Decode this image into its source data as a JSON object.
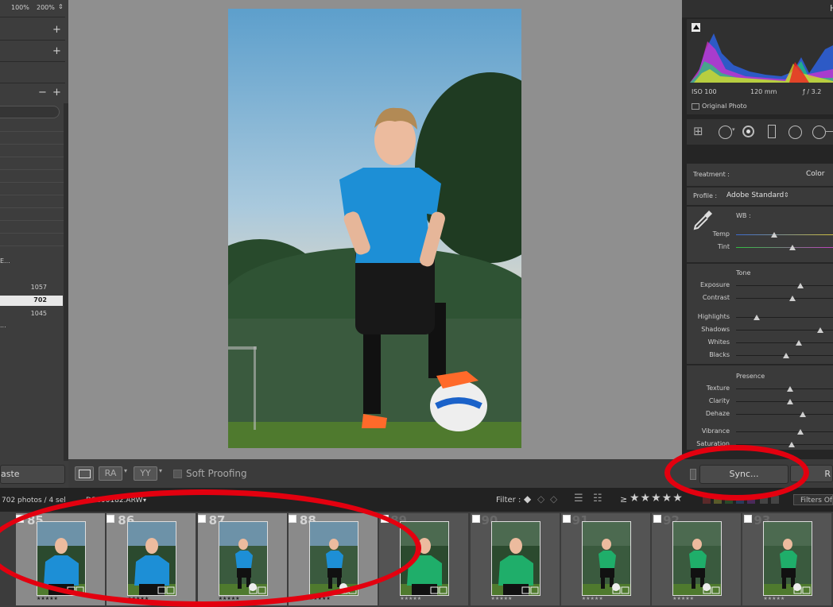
{
  "left_panel": {
    "zoom_options": [
      "100%",
      "200%"
    ],
    "counts": [
      "1057",
      "702",
      "1045"
    ],
    "truncated_item": "E...",
    "dots": "...",
    "paste_label": "aste"
  },
  "toolbar": {
    "ra_label": "RA",
    "yy_label": "YY",
    "soft_proofing_label": "Soft Proofing"
  },
  "right_panel": {
    "top_letter": "H",
    "histogram_info": {
      "iso": "ISO 100",
      "focal": "120 mm",
      "aperture": "ƒ / 3.2"
    },
    "original_photo_label": "Original Photo",
    "treatment_label": "Treatment :",
    "treatment_value": "Color",
    "profile_label": "Profile :",
    "profile_value": "Adobe Standard",
    "wb_label": "WB :",
    "sliders_wb": [
      {
        "label": "Temp",
        "value": 0.39
      },
      {
        "label": "Tint",
        "value": 0.58
      }
    ],
    "tone_label": "Tone",
    "sliders_tone_a": [
      {
        "label": "Exposure",
        "value": 0.66
      },
      {
        "label": "Contrast",
        "value": 0.58
      }
    ],
    "sliders_tone_b": [
      {
        "label": "Highlights",
        "value": 0.21
      },
      {
        "label": "Shadows",
        "value": 0.87
      },
      {
        "label": "Whites",
        "value": 0.65
      },
      {
        "label": "Blacks",
        "value": 0.52
      }
    ],
    "presence_label": "Presence",
    "sliders_presence_a": [
      {
        "label": "Texture",
        "value": 0.56
      },
      {
        "label": "Clarity",
        "value": 0.56
      },
      {
        "label": "Dehaze",
        "value": 0.69
      }
    ],
    "sliders_presence_b": [
      {
        "label": "Vibrance",
        "value": 0.66
      },
      {
        "label": "Saturation",
        "value": 0.57
      }
    ],
    "sync_label": "Sync...",
    "reset_letter": "R"
  },
  "filmbar": {
    "count_text": "702 photos / 4 sel",
    "file_text": "DSC00182.ARW",
    "filter_label": "Filter :",
    "filters_off": "Filters Off"
  },
  "filmstrip": {
    "cells": [
      {
        "num": "85",
        "jersey": "blue",
        "pose": "portrait",
        "selected": true
      },
      {
        "num": "86",
        "jersey": "blue",
        "pose": "portrait",
        "selected": true
      },
      {
        "num": "87",
        "jersey": "blue",
        "pose": "full",
        "selected": true
      },
      {
        "num": "88",
        "jersey": "blue",
        "pose": "full",
        "selected": true
      },
      {
        "num": "89",
        "jersey": "green",
        "pose": "portrait",
        "selected": false
      },
      {
        "num": "90",
        "jersey": "green",
        "pose": "portrait",
        "selected": false
      },
      {
        "num": "91",
        "jersey": "green",
        "pose": "full",
        "selected": false
      },
      {
        "num": "92",
        "jersey": "green",
        "pose": "full",
        "selected": false
      },
      {
        "num": "93",
        "jersey": "green",
        "pose": "full",
        "selected": false
      }
    ],
    "stars": "★★★★★"
  },
  "colors": {
    "annotation_red": "#e3000f",
    "panel_bg": "#3a3a3a",
    "canvas_bg": "#8f8f8f"
  }
}
